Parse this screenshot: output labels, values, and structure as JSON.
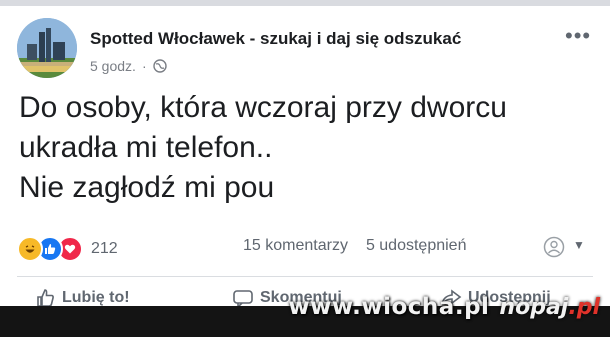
{
  "post": {
    "page_name": "Spotted Włocławek - szukaj i daj się odszukać",
    "time": "5 godz.",
    "separator": "·",
    "privacy_icon": "globe-icon",
    "more_label": "•••",
    "text_lines": [
      "Do osoby, która wczoraj przy dworcu",
      "ukradła mi telefon..",
      "Nie zagłodź mi pou"
    ]
  },
  "engagement": {
    "reactions": [
      "haha",
      "like",
      "love"
    ],
    "reaction_count": "212",
    "comments": "15 komentarzy",
    "shares": "5 udostępnień"
  },
  "actions": [
    {
      "label": "Lubię to!",
      "icon": "thumbs-up-icon"
    },
    {
      "label": "Skomentuj",
      "icon": "comment-icon"
    },
    {
      "label": "Udostępnij",
      "icon": "share-icon"
    }
  ],
  "watermark": {
    "url": "www.wiocha.pl",
    "logo_main": "nopaj",
    "logo_tld": ".pl"
  },
  "colors": {
    "text": "#1c1e21",
    "secondary": "#606770",
    "like_blue": "#1877f2",
    "love_red": "#f0284a",
    "haha_yellow": "#f7b928"
  }
}
